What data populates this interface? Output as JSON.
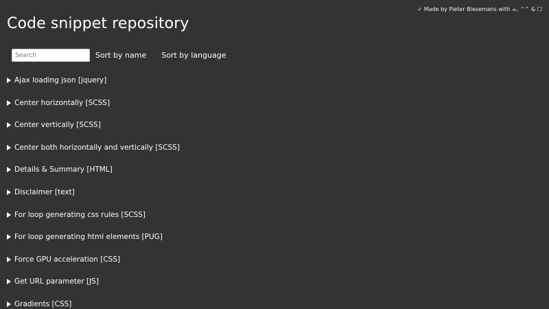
{
  "header": {
    "credit": "✓ Made by Pieter Biesemans with ☕, ⌃⌃ & ☐",
    "title": "Code snippet repository"
  },
  "controls": {
    "search_placeholder": "Search",
    "sort_by_name": "Sort by name",
    "sort_by_language": "Sort by language"
  },
  "snippets": [
    {
      "label": "Ajax loading json [jquery]"
    },
    {
      "label": "Center horizontally [SCSS]"
    },
    {
      "label": "Center vertically [SCSS]"
    },
    {
      "label": "Center both horizontally and vertically [SCSS]"
    },
    {
      "label": "Details & Summary [HTML]"
    },
    {
      "label": "Disclaimer [text]"
    },
    {
      "label": "For loop generating css rules [SCSS]"
    },
    {
      "label": "For loop generating html elements [PUG]"
    },
    {
      "label": "Force GPU acceleration [CSS]"
    },
    {
      "label": "Get URL parameter [JS]"
    },
    {
      "label": "Gradients [CSS]"
    }
  ]
}
